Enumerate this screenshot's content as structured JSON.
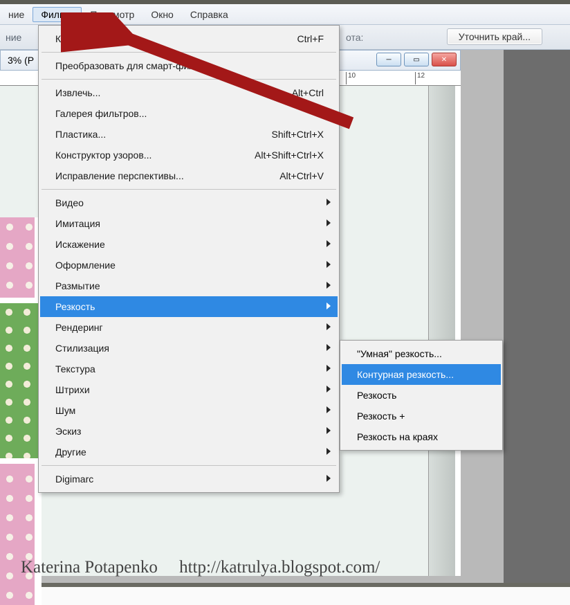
{
  "menubar": {
    "items": [
      "ние",
      "Фильтр",
      "Просмотр",
      "Окно",
      "Справка"
    ],
    "active_index": 1
  },
  "toolbar": {
    "left_label": "ние",
    "right_fragment": "ота:",
    "refine_button": "Уточнить край..."
  },
  "document": {
    "title_fragment": "3% (Р",
    "ruler_marks": [
      "10",
      "12"
    ]
  },
  "filter_menu": {
    "group1": [
      {
        "label": "Контурная ре",
        "shortcut": "Ctrl+F"
      },
      {
        "label": "Преобразовать для смарт-фил       ов",
        "shortcut": ""
      }
    ],
    "group2": [
      {
        "label": "Извлечь...",
        "shortcut": "Alt+Ctrl"
      },
      {
        "label": "Галерея фильтров...",
        "shortcut": ""
      },
      {
        "label": "Пластика...",
        "shortcut": "Shift+Ctrl+X"
      },
      {
        "label": "Конструктор узоров...",
        "shortcut": "Alt+Shift+Ctrl+X"
      },
      {
        "label": "Исправление перспективы...",
        "shortcut": "Alt+Ctrl+V"
      }
    ],
    "group3": [
      "Видео",
      "Имитация",
      "Искажение",
      "Оформление",
      "Размытие",
      "Резкость",
      "Рендеринг",
      "Стилизация",
      "Текстура",
      "Штрихи",
      "Шум",
      "Эскиз",
      "Другие"
    ],
    "highlight_index": 5,
    "group4": [
      "Digimarc"
    ]
  },
  "sharpen_submenu": {
    "items": [
      "\"Умная\" резкость...",
      "Контурная резкость...",
      "Резкость",
      "Резкость +",
      "Резкость на краях"
    ],
    "highlight_index": 1
  },
  "watermark": {
    "name": "Katerina Potapenko",
    "url": "http://katrulya.blogspot.com/"
  },
  "window_controls": {
    "min": "─",
    "max": "▭",
    "close": "✕"
  }
}
